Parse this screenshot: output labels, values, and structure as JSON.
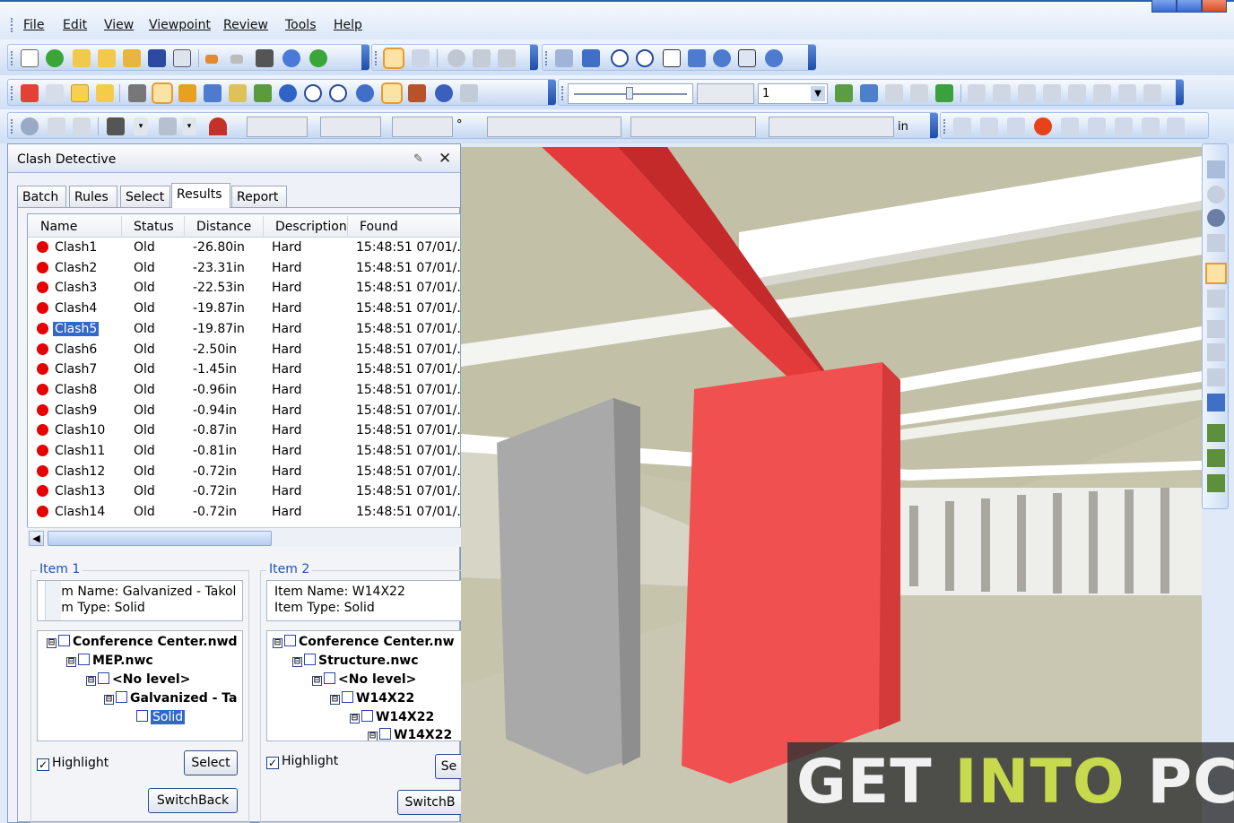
{
  "menu": {
    "items": [
      "File",
      "Edit",
      "View",
      "Viewpoint",
      "Review",
      "Tools",
      "Help"
    ]
  },
  "toolbar": {
    "value_field": "1",
    "unit_label": "in",
    "degree_symbol": "°"
  },
  "clash_detective": {
    "title": "Clash Detective",
    "tabs": [
      "Batch",
      "Rules",
      "Select",
      "Results",
      "Report"
    ],
    "active_tab": "Results",
    "columns": [
      "Name",
      "Status",
      "Distance",
      "Description",
      "Found"
    ],
    "rows": [
      {
        "name": "Clash1",
        "status": "Old",
        "distance": "-26.80in",
        "description": "Hard",
        "found": "15:48:51 07/01/.."
      },
      {
        "name": "Clash2",
        "status": "Old",
        "distance": "-23.31in",
        "description": "Hard",
        "found": "15:48:51 07/01/.."
      },
      {
        "name": "Clash3",
        "status": "Old",
        "distance": "-22.53in",
        "description": "Hard",
        "found": "15:48:51 07/01/.."
      },
      {
        "name": "Clash4",
        "status": "Old",
        "distance": "-19.87in",
        "description": "Hard",
        "found": "15:48:51 07/01/.."
      },
      {
        "name": "Clash5",
        "status": "Old",
        "distance": "-19.87in",
        "description": "Hard",
        "found": "15:48:51 07/01/.."
      },
      {
        "name": "Clash6",
        "status": "Old",
        "distance": "-2.50in",
        "description": "Hard",
        "found": "15:48:51 07/01/.."
      },
      {
        "name": "Clash7",
        "status": "Old",
        "distance": "-1.45in",
        "description": "Hard",
        "found": "15:48:51 07/01/.."
      },
      {
        "name": "Clash8",
        "status": "Old",
        "distance": "-0.96in",
        "description": "Hard",
        "found": "15:48:51 07/01/.."
      },
      {
        "name": "Clash9",
        "status": "Old",
        "distance": "-0.94in",
        "description": "Hard",
        "found": "15:48:51 07/01/.."
      },
      {
        "name": "Clash10",
        "status": "Old",
        "distance": "-0.87in",
        "description": "Hard",
        "found": "15:48:51 07/01/.."
      },
      {
        "name": "Clash11",
        "status": "Old",
        "distance": "-0.81in",
        "description": "Hard",
        "found": "15:48:51 07/01/.."
      },
      {
        "name": "Clash12",
        "status": "Old",
        "distance": "-0.72in",
        "description": "Hard",
        "found": "15:48:51 07/01/.."
      },
      {
        "name": "Clash13",
        "status": "Old",
        "distance": "-0.72in",
        "description": "Hard",
        "found": "15:48:51 07/01/.."
      },
      {
        "name": "Clash14",
        "status": "Old",
        "distance": "-0.72in",
        "description": "Hard",
        "found": "15:48:51 07/01/.."
      }
    ],
    "selected_row": "Clash5",
    "item1": {
      "caption": "Item 1",
      "item_name": "Item Name: Galvanized - Takol",
      "item_type": "Item Type: Solid",
      "tree": [
        "Conference Center.nwd",
        "MEP.nwc",
        "<No level>",
        "Galvanized - Ta",
        "Solid"
      ],
      "highlight_label": "Highlight",
      "select_label": "Select",
      "switchback_label": "SwitchBack"
    },
    "item2": {
      "caption": "Item 2",
      "item_name": "Item Name: W14X22",
      "item_type": "Item Type: Solid",
      "tree": [
        "Conference Center.nw",
        "Structure.nwc",
        "<No level>",
        "W14X22",
        "W14X22",
        "W14X22"
      ],
      "highlight_label": "Highlight",
      "select_label": "Se",
      "switchback_label": "SwitchB"
    }
  },
  "colors": {
    "clash_dot": "#e60000",
    "selection": "#3168c9",
    "red_element": "#f05050",
    "gray_element": "#a9a9a9"
  },
  "watermark": {
    "part1": "GET ",
    "part2": "INTO",
    "part3": " PC"
  }
}
